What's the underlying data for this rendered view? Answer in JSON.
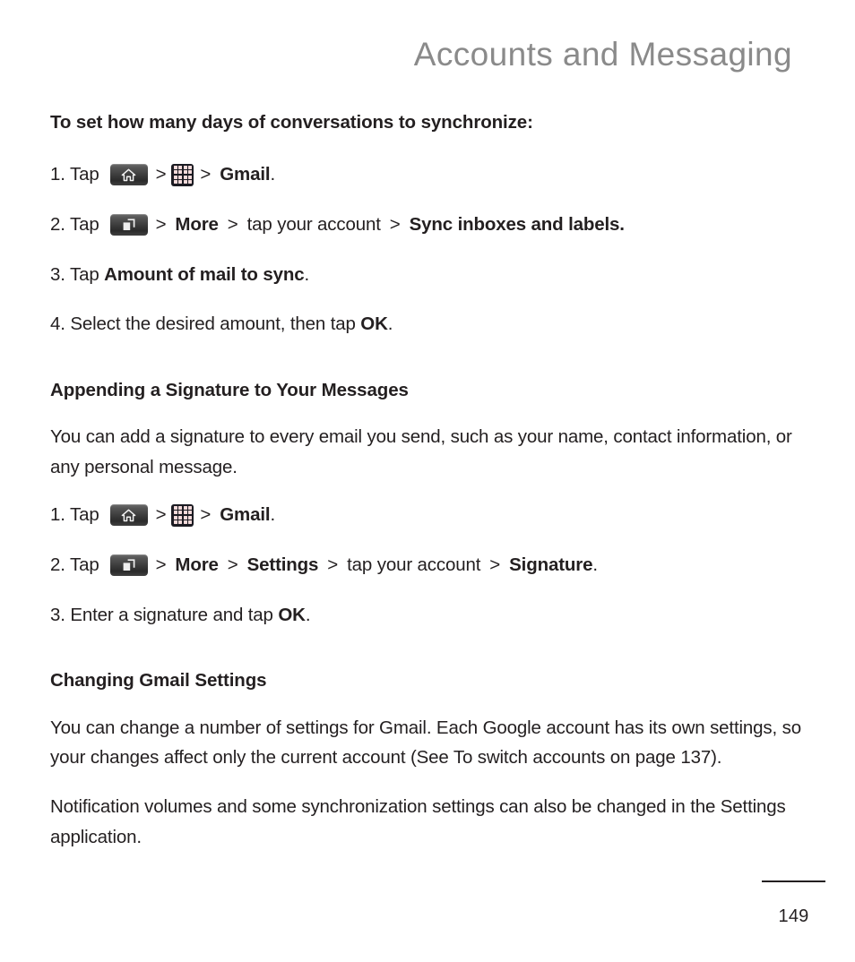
{
  "header": {
    "title": "Accounts and Messaging",
    "color": "#8a8a8a"
  },
  "icons": {
    "home": "home-key-icon",
    "menu": "menu-key-icon",
    "apps": "apps-grid-icon"
  },
  "section_sync": {
    "heading": "To set how many days of conversations to synchronize:",
    "steps": [
      {
        "number": "1. Tap",
        "after_home": ">",
        "after_apps": ">",
        "tail_bold": "Gmail",
        "tail_plain": "."
      },
      {
        "number": "2. Tap",
        "after_menu": ">",
        "b1": "More",
        "s1": ">",
        "t1": "tap your account",
        "s2": ">",
        "b2": "Sync inboxes and labels."
      },
      {
        "prefix": "3. Tap ",
        "bold": "Amount of mail to sync",
        "suffix": "."
      },
      {
        "prefix": "4. Select the desired amount, then tap ",
        "bold": "OK",
        "suffix": "."
      }
    ]
  },
  "section_signature": {
    "heading": "Appending a Signature to Your Messages",
    "paragraph": "You can add a signature to every email you send, such as your name, contact information, or any personal message.",
    "steps": [
      {
        "number": "1. Tap",
        "after_home": ">",
        "after_apps": ">",
        "tail_bold": "Gmail",
        "tail_plain": "."
      },
      {
        "number": "2. Tap",
        "after_menu": ">",
        "b1": "More",
        "s1": ">",
        "b2": "Settings",
        "s2": ">",
        "t1": "tap your account",
        "s3": ">",
        "b3": "Signature",
        "tail": "."
      },
      {
        "prefix": "3. Enter a signature and tap ",
        "bold": "OK",
        "suffix": "."
      }
    ]
  },
  "section_settings": {
    "heading": "Changing Gmail Settings",
    "paragraph1": "You can change a number of settings for Gmail. Each Google account has its own settings, so your changes affect only the current account (See To switch accounts on page 137).",
    "paragraph2": "Notification volumes and some synchronization settings can also be changed in the Settings application."
  },
  "footer": {
    "page_number": "149"
  }
}
